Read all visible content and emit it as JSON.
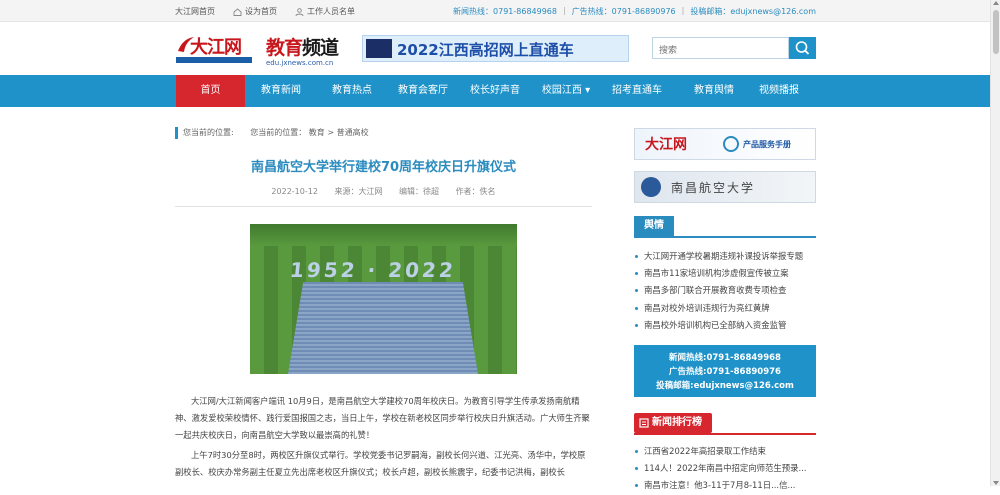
{
  "topbar": {
    "home_link": "大江网首页",
    "set_home": "设为首页",
    "staff_list": "工作人员名单",
    "news_hotline": "新闻热线：0791-86849968",
    "ad_hotline": "广告热线：0791-86890976",
    "email": "投稿邮箱：edujxnews@126.com"
  },
  "header": {
    "logo_text": "大江网",
    "channel_title_a": "教育",
    "channel_title_b": "频道",
    "channel_url": "edu.jxnews.com.cn",
    "banner_text": "2022江西高招网上直通车",
    "search_placeholder": "搜索"
  },
  "nav": [
    "首页",
    "教育新闻",
    "教育热点",
    "教育会客厅",
    "校长好声音",
    "校园江西 ▾",
    "招考直通车",
    "教育舆情",
    "视频播报"
  ],
  "breadcrumb": {
    "label": "您当前的位置:",
    "path": "您当前的位置：  教育 > 普通高校"
  },
  "article": {
    "title": "南昌航空大学举行建校70周年校庆日升旗仪式",
    "date": "2022-10-12",
    "source": "来源：大江网",
    "editor": "编辑：徐超",
    "author": "作者：佚名",
    "photo_text": "1952 · 2022",
    "paragraphs": [
      "大江网/大江新闻客户端讯 10月9日，是南昌航空大学建校70周年校庆日。为教育引导学生传承发扬南航精神、激发爱校荣校情怀、践行爱国报国之志，当日上午，学校在新老校区同步举行校庆日升旗活动。广大师生齐聚一起共庆校庆日，向南昌航空大学致以最崇高的礼赞！",
      "上午7时30分至8时，两校区升旗仪式举行。学校党委书记罗嗣海，副校长何兴道、江光亮、汤华中，学校原副校长、校庆办常务副主任夏立先出席老校区升旗仪式；校长卢超，副校长熊震宇，纪委书记洪梅，副校长"
    ]
  },
  "sidebar": {
    "ad1_logo": "大江网",
    "ad1_text": "产品服务手册",
    "ad2_text": "南昌航空大学",
    "section1": "舆情",
    "yuqing": [
      "大江网开通学校暑期违规补课投诉举报专题",
      "南昌市11家培训机构涉虚假宣传被立案",
      "南昌多部门联合开展教育收费专项检查",
      "南昌对校外培训违规行为亮红黄牌",
      "南昌校外培训机构已全部纳入资金监管"
    ],
    "contact": [
      "新闻热线:0791-86849968",
      "广告热线:0791-86890976",
      "投稿邮箱:edujxnews@126.com"
    ],
    "section2": "新闻排行榜",
    "ranking": [
      "江西省2022年高招录取工作结束",
      "114人！2022年南昌中招定向师范生预录...",
      "南昌市注意！他3-11于7月8-11日...信..."
    ]
  },
  "colors": {
    "accent": "#1f93c9",
    "active": "#d6262e"
  }
}
